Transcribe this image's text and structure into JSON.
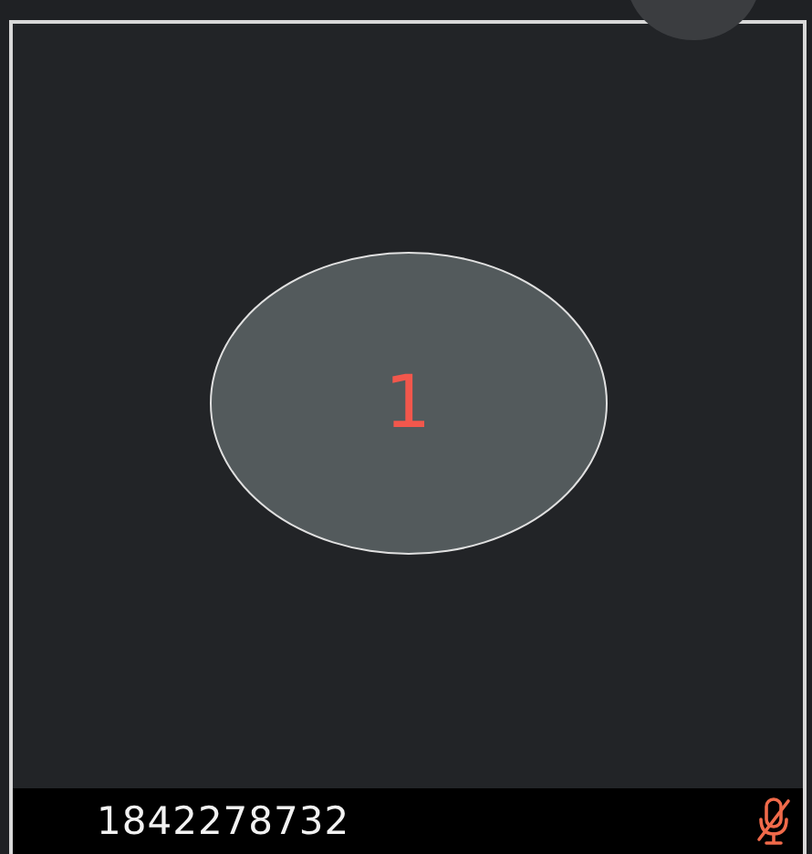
{
  "tile": {
    "number": "1"
  },
  "footer": {
    "caller_id": "1842278732",
    "muted": true
  }
}
